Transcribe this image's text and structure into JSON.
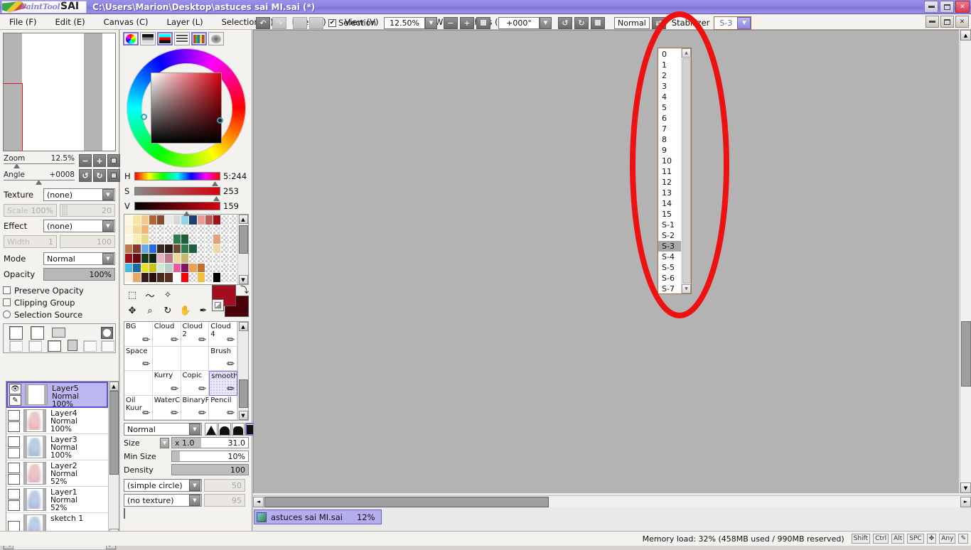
{
  "window": {
    "app_name_paint": "PaintTool",
    "app_name_sai": "SAI",
    "title": "C:\\Users\\Marion\\Desktop\\astuces sai MI.sai (*)",
    "minimize_label": "",
    "maximize_label": "",
    "close_label": "✕",
    "inner_minimize_label": "",
    "inner_maximize_label": "",
    "inner_close_label": "✕"
  },
  "menubar": {
    "items": [
      {
        "label": "File (F)"
      },
      {
        "label": "Edit (E)"
      },
      {
        "label": "Canvas (C)"
      },
      {
        "label": "Layer (L)"
      },
      {
        "label": "Selection (S)"
      },
      {
        "label": "Filter (T)"
      },
      {
        "label": "View (V)"
      },
      {
        "label": "Window (W)"
      },
      {
        "label": "Others (O)"
      }
    ]
  },
  "toolbar": {
    "undo_label": "↶",
    "redo_label": "↷",
    "sel_deselect_label": "",
    "sel_invert_label": "",
    "selection_checkbox_label": "Selection",
    "selection_checkbox_checked": "✔",
    "zoom_value": "12.50%",
    "zoom_out_label": "−",
    "zoom_in_label": "+",
    "zoom_reset_label": "",
    "rotate_value": "+000°",
    "rotate_ccw_label": "↺",
    "rotate_cw_label": "↻",
    "rotate_reset_label": "",
    "mode_value": "Normal",
    "flip_label": "⇄",
    "stabilizer_label": "Stabilizer",
    "stabilizer_value": "S-3",
    "dropdown_arrow": "▼"
  },
  "stabilizer_dropdown": {
    "options": [
      "0",
      "1",
      "2",
      "3",
      "4",
      "5",
      "6",
      "7",
      "8",
      "9",
      "10",
      "11",
      "12",
      "13",
      "14",
      "15",
      "S-1",
      "S-2",
      "S-3",
      "S-4",
      "S-5",
      "S-6",
      "S-7"
    ],
    "selected": "S-3",
    "scroll_up_label": "▲",
    "scroll_down_label": "▼"
  },
  "navigator": {
    "zoom_label": "Zoom",
    "zoom_value": "12.5%",
    "angle_label": "Angle",
    "angle_value": "+0008",
    "zoom_out_label": "−",
    "zoom_in_label": "+",
    "zoom_reset_label": "",
    "rotate_left_label": "↺",
    "rotate_right_label": "↻",
    "rotate_reset_label": ""
  },
  "layer_props": {
    "texture_label": "Texture",
    "texture_value": "(none)",
    "scale_label": "Scale",
    "scale_value": "100%",
    "scale_amount": "20",
    "effect_label": "Effect",
    "effect_value": "(none)",
    "width_label": "Width",
    "width_value": "1",
    "width_amount": "100",
    "mode_label": "Mode",
    "mode_value": "Normal",
    "opacity_label": "Opacity",
    "opacity_value": "100%",
    "preserve_opacity_label": "Preserve Opacity",
    "clipping_group_label": "Clipping Group",
    "selection_source_label": "Selection Source"
  },
  "layers": {
    "toolbar": {
      "new_layer": "new-layer",
      "new_linework_layer": "new-linework-layer",
      "new_folder": "new-folder",
      "mask": "layer-mask",
      "merge_down": "merge-down",
      "clear": "clear-layer",
      "delete": "delete-layer"
    },
    "items": [
      {
        "name": "Layer5",
        "mode": "Normal",
        "opacity": "100%",
        "selected": true,
        "thumb": "blank"
      },
      {
        "name": "Layer4",
        "mode": "Normal",
        "opacity": "100%",
        "selected": false,
        "thumb": "pink"
      },
      {
        "name": "Layer3",
        "mode": "Normal",
        "opacity": "100%",
        "selected": false,
        "thumb": "blue"
      },
      {
        "name": "Layer2",
        "mode": "Normal",
        "opacity": "52%",
        "selected": false,
        "thumb": "pink"
      },
      {
        "name": "Layer1",
        "mode": "Normal",
        "opacity": "52%",
        "selected": false,
        "thumb": "blue"
      },
      {
        "name": "sketch 1",
        "mode": "",
        "opacity": "",
        "selected": false,
        "thumb": "blue"
      }
    ]
  },
  "color": {
    "mode_buttons": [
      "color-wheel",
      "gradient-bar",
      "rgb-slider",
      "palette-list",
      "swatch-grid",
      "scratch-pad"
    ],
    "h_label": "H",
    "h_value": "5:244",
    "s_label": "S",
    "s_value": "253",
    "v_label": "V",
    "v_value": "159",
    "primary": "#a30d1e",
    "secondary": "#4a0008"
  },
  "tools": {
    "row1": [
      "rect-select-icon",
      "lasso-select-icon",
      "magic-wand-icon",
      "",
      ""
    ],
    "row2": [
      "move-icon",
      "zoom-icon",
      "rotate-icon",
      "pan-icon",
      "eyedropper-icon"
    ]
  },
  "brushes": {
    "cells": [
      {
        "label": "BG",
        "selected": false
      },
      {
        "label": "Cloud",
        "selected": false
      },
      {
        "label": "Cloud 2",
        "selected": false
      },
      {
        "label": "Cloud 4",
        "selected": false
      },
      {
        "label": "Space",
        "selected": false
      },
      {
        "label": "",
        "selected": false
      },
      {
        "label": "",
        "selected": false
      },
      {
        "label": "Brush",
        "selected": false
      },
      {
        "label": "",
        "selected": false
      },
      {
        "label": "Kurry",
        "selected": false
      },
      {
        "label": "Copic",
        "selected": false
      },
      {
        "label": "smooth",
        "selected": true
      },
      {
        "label": "Oil Kuur",
        "selected": false
      },
      {
        "label": "WaterCo",
        "selected": false
      },
      {
        "label": "BinaryP‹",
        "selected": false
      },
      {
        "label": "Pencil",
        "selected": false
      }
    ]
  },
  "brush_settings": {
    "blend_mode": "Normal",
    "size_label": "Size",
    "size_multiplier": "x 1.0",
    "size_value": "31.0",
    "min_size_label": "Min Size",
    "min_size_value": "10%",
    "density_label": "Density",
    "density_value": "100",
    "shape_value": "(simple circle)",
    "shape_amount": "50",
    "texture_value": "(no texture)",
    "texture_amount": "95"
  },
  "document_tab": {
    "name": "astuces sai MI.sai",
    "zoom": "12%"
  },
  "statusbar": {
    "memory": "Memory load: 32% (458MB used / 990MB reserved)",
    "keys": [
      "Shift",
      "Ctrl",
      "Alt",
      "SPC",
      "✥",
      "Any"
    ],
    "pen_icon": "pen-icon"
  },
  "annotation": {
    "shape": "red-ellipse-highlight",
    "color": "#ee1111"
  }
}
